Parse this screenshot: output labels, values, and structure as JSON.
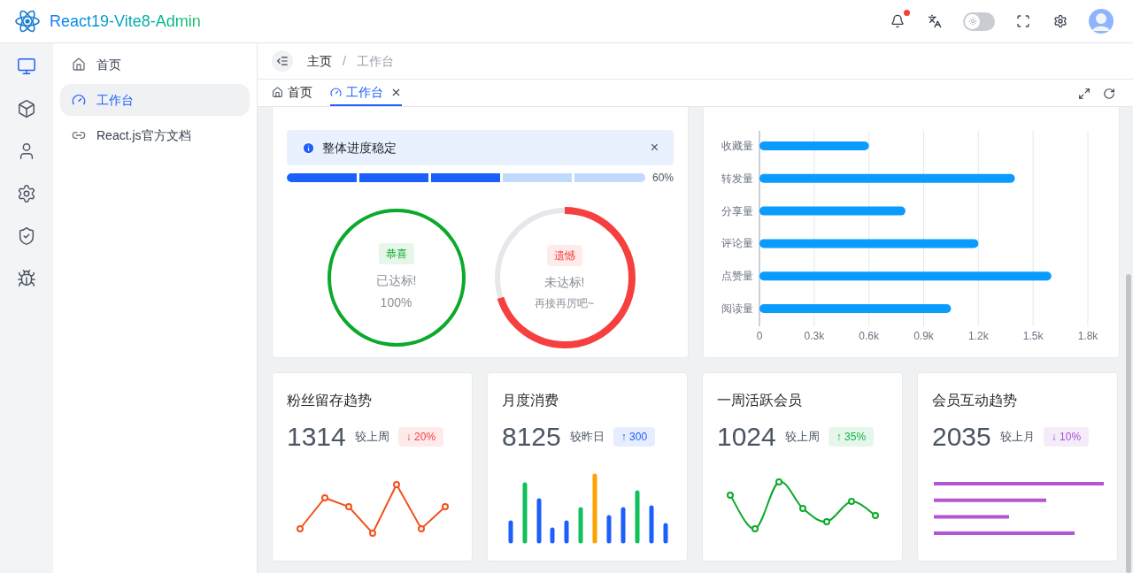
{
  "header": {
    "title": "React19-Vite8-Admin",
    "notifications": {
      "unread": true
    },
    "dark_mode": {
      "on": false
    }
  },
  "rail": [
    {
      "selected": true
    },
    {
      "selected": false
    },
    {
      "selected": false
    },
    {
      "selected": false
    },
    {
      "selected": false
    },
    {
      "selected": false
    }
  ],
  "menu": [
    {
      "label": "首页",
      "selected": false
    },
    {
      "label": "工作台",
      "selected": true
    },
    {
      "label": "React.js官方文档",
      "selected": false
    }
  ],
  "breadcrumb": [
    {
      "label": "主页"
    },
    {
      "label": "/"
    },
    {
      "label": "工作台"
    }
  ],
  "tabs": [
    {
      "label": "首页",
      "selected": false,
      "closable": false
    },
    {
      "label": "工作台",
      "selected": true,
      "closable": true
    }
  ],
  "goal_card": {
    "alert": "整体进度稳定",
    "close": "×",
    "progress": {
      "level": 0.6,
      "reading": "60%"
    },
    "rings": [
      {
        "level": 1,
        "color": "#0aaa2a",
        "tag": "恭喜",
        "line1": "已达标!",
        "line2": "100%"
      },
      {
        "level": 0.7,
        "color": "#f5403f",
        "tag": "遗憾",
        "line1": "未达标!",
        "line2": "再接再厉吧~"
      }
    ]
  },
  "stats_card": {
    "chart_data": {
      "type": "bar",
      "orientation": "horizontal",
      "grid": true,
      "categories": [
        "收藏量",
        "转发量",
        "分享量",
        "评论量",
        "点赞量",
        "阅读量"
      ],
      "series": [
        {
          "color": "#0a9bff",
          "values": [
            600,
            1400,
            800,
            1200,
            1600,
            1050
          ]
        }
      ],
      "xlim": [
        0,
        1800
      ],
      "xticks": [
        {
          "value": 0,
          "label": "0"
        },
        {
          "value": 300,
          "label": "0.3k"
        },
        {
          "value": 600,
          "label": "0.6k"
        },
        {
          "value": 900,
          "label": "0.9k"
        },
        {
          "value": 1200,
          "label": "1.2k"
        },
        {
          "value": 1500,
          "label": "1.5k"
        },
        {
          "value": 1800,
          "label": "1.8k"
        }
      ]
    }
  },
  "metric_cards": [
    {
      "title": "粉丝留存趋势",
      "value": "1314",
      "compare": "较上周",
      "delta": "↓ 20%",
      "color": "#f5403f",
      "kind": "line"
    },
    {
      "title": "月度消费",
      "value": "8125",
      "compare": "较昨日",
      "delta": "↑ 300",
      "color": "#1d5ffc",
      "kind": "bars"
    },
    {
      "title": "一周活跃会员",
      "value": "1024",
      "compare": "较上周",
      "delta": "↑ 35%",
      "color": "#14b045",
      "kind": "curve"
    },
    {
      "title": "会员互动趋势",
      "value": "2035",
      "compare": "较上月",
      "delta": "↓ 10%",
      "color": "#a64fd6",
      "kind": "lines"
    }
  ]
}
